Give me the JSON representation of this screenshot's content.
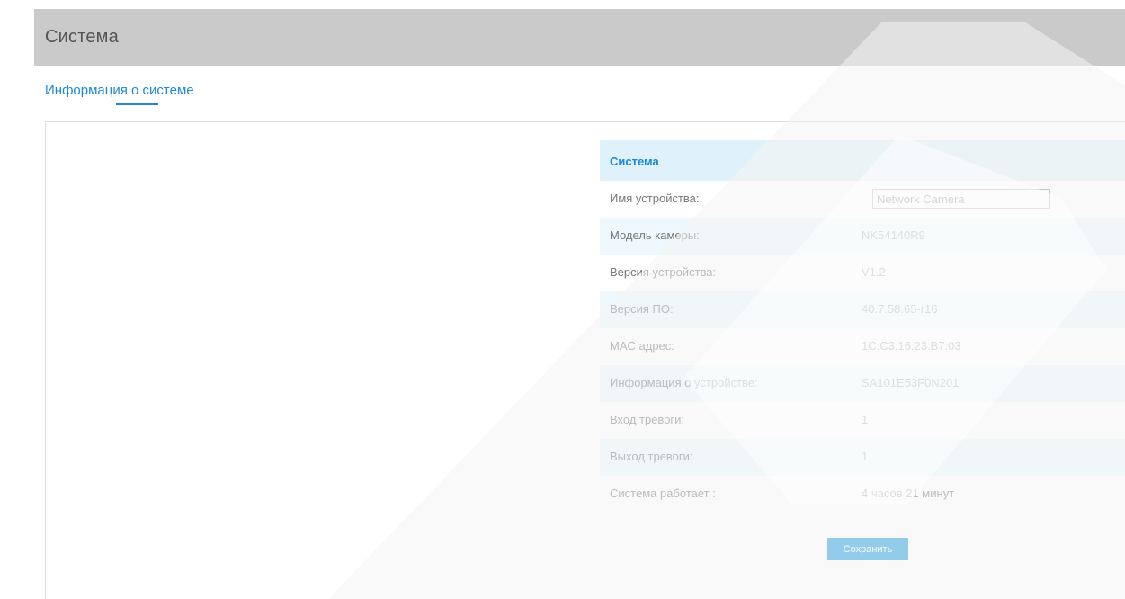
{
  "header": {
    "title": "Система"
  },
  "tabs": [
    {
      "label": "Информация о системе",
      "active": true
    }
  ],
  "section": {
    "title": "Система"
  },
  "fields": {
    "device_name": {
      "label": "Имя устройства:",
      "value": "Network Camera"
    },
    "camera_model": {
      "label": "Модель камеры:",
      "value": "NK54140R9"
    },
    "device_version": {
      "label": "Версия устройства:",
      "value": "V1.2"
    },
    "firmware_version": {
      "label": "Версия ПО:",
      "value": "40.7.58.65-r16"
    },
    "mac_address": {
      "label": "MAC адрес:",
      "value": "1C:C3:16:23:B7:03"
    },
    "device_info": {
      "label": "Информация о устройстве:",
      "value": "SA101E53F0N201"
    },
    "alarm_input": {
      "label": "Вход тревоги:",
      "value": "1"
    },
    "alarm_output": {
      "label": "Выход тревоги:",
      "value": "1"
    },
    "uptime": {
      "label": "Система работает :",
      "value": "4 часов 21 минут"
    }
  },
  "buttons": {
    "save_label": "Сохранить"
  },
  "colors": {
    "accent": "#1e88d4",
    "header_bg": "#cacaca",
    "section_bg": "#dff1fb",
    "row_alt_bg": "#eef8fd",
    "button_bg": "#1e9be0"
  }
}
